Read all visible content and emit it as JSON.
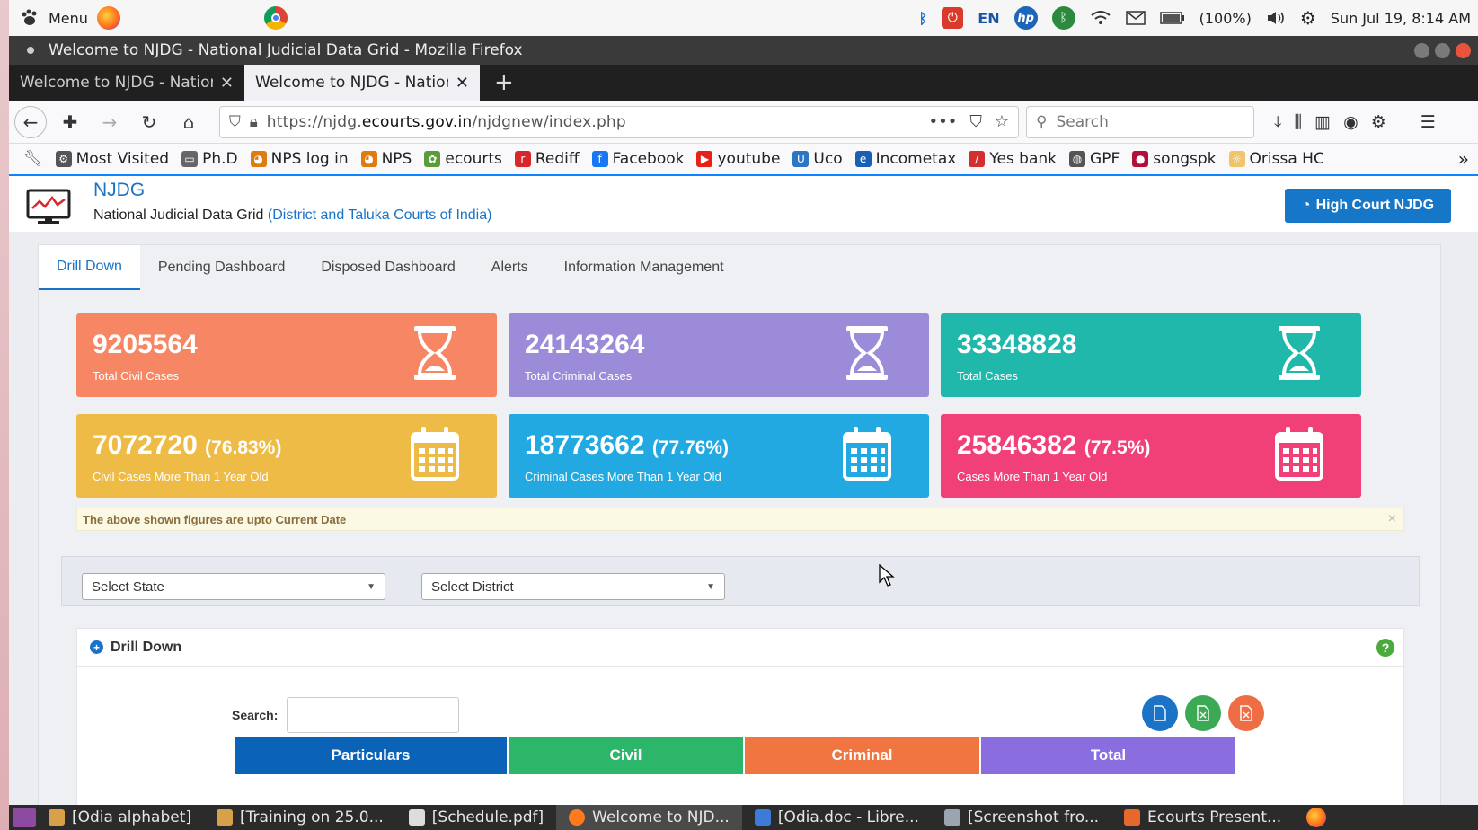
{
  "system_panel": {
    "menu_label": "Menu",
    "language": "EN",
    "battery": "(100%)",
    "datetime": "Sun Jul 19,  8:14 AM"
  },
  "window": {
    "title": "Welcome to NJDG - National Judicial Data Grid - Mozilla Firefox"
  },
  "browser_tabs": [
    {
      "label": "Welcome to NJDG - Nationa"
    },
    {
      "label": "Welcome to NJDG - Nationa"
    }
  ],
  "navbar": {
    "url_prefix": "https://njdg.",
    "url_domain": "ecourts.gov.in",
    "url_path": "/njdgnew/index.php",
    "search_placeholder": "Search"
  },
  "bookmarks": [
    {
      "label": "Most Visited",
      "icon": "gear-icon",
      "color": "#555555"
    },
    {
      "label": "Ph.D",
      "icon": "folder-icon",
      "color": "#666666"
    },
    {
      "label": "NPS log in",
      "icon": "nps-icon",
      "color": "#e07b10"
    },
    {
      "label": "NPS",
      "icon": "nps-icon",
      "color": "#e07b10"
    },
    {
      "label": "ecourts",
      "icon": "ecourts-icon",
      "color": "#5a9c3a"
    },
    {
      "label": "Rediff",
      "icon": "rediff-icon",
      "color": "#d8262b"
    },
    {
      "label": "Facebook",
      "icon": "facebook-icon",
      "color": "#1877f2"
    },
    {
      "label": "youtube",
      "icon": "youtube-icon",
      "color": "#e62117"
    },
    {
      "label": "Uco",
      "icon": "uco-icon",
      "color": "#2c77c4"
    },
    {
      "label": "Incometax",
      "icon": "incometax-icon",
      "color": "#1a5fb4"
    },
    {
      "label": "Yes bank",
      "icon": "yesbank-icon",
      "color": "#d32f2f"
    },
    {
      "label": "GPF",
      "icon": "globe-icon",
      "color": "#555555"
    },
    {
      "label": "songspk",
      "icon": "songspk-icon",
      "color": "#b0103a"
    },
    {
      "label": "Orissa HC",
      "icon": "orissahc-icon",
      "color": "#f1c36b"
    }
  ],
  "header": {
    "site_name": "NJDG",
    "subtitle": "National Judicial Data Grid",
    "subtitle_paren": "(District and Taluka Courts of India)",
    "hc_button": "High Court NJDG"
  },
  "nav_tabs": [
    {
      "label": "Drill Down",
      "active": true
    },
    {
      "label": "Pending Dashboard"
    },
    {
      "label": "Disposed Dashboard"
    },
    {
      "label": "Alerts"
    },
    {
      "label": "Information Management"
    }
  ],
  "cards": [
    {
      "value": "9205564",
      "pct": "",
      "label": "Total Civil Cases",
      "icon": "hourglass-icon",
      "color": "#f78764"
    },
    {
      "value": "24143264",
      "pct": "",
      "label": "Total Criminal Cases",
      "icon": "hourglass-icon",
      "color": "#9c8bd8"
    },
    {
      "value": "33348828",
      "pct": "",
      "label": "Total Cases",
      "icon": "hourglass-icon",
      "color": "#21b8ac"
    },
    {
      "value": "7072720",
      "pct": "(76.83%)",
      "label": "Civil Cases More Than 1 Year Old",
      "icon": "calendar-icon",
      "color": "#eebc46"
    },
    {
      "value": "18773662",
      "pct": "(77.76%)",
      "label": "Criminal Cases More Than 1 Year Old",
      "icon": "calendar-icon",
      "color": "#23a9e1"
    },
    {
      "value": "25846382",
      "pct": "(77.5%)",
      "label": "Cases More Than 1 Year Old",
      "icon": "calendar-icon",
      "color": "#f13f77"
    }
  ],
  "alert": {
    "text": "The above shown figures are upto Current Date",
    "close": "×"
  },
  "filters": {
    "state": "Select State",
    "district": "Select District"
  },
  "drill_down": {
    "title": "Drill Down",
    "search_label": "Search:",
    "help": "?",
    "columns": [
      {
        "label": "Particulars",
        "color": "#0b63b8"
      },
      {
        "label": "Civil",
        "color": "#2cb66a"
      },
      {
        "label": "Criminal",
        "color": "#f07540"
      },
      {
        "label": "Total",
        "color": "#8a6ee0"
      }
    ]
  },
  "taskbar": [
    {
      "label": "[Odia alphabet]",
      "icon": "folder-icon"
    },
    {
      "label": "[Training on 25.0...",
      "icon": "folder-icon"
    },
    {
      "label": "[Schedule.pdf]",
      "icon": "pdf-icon"
    },
    {
      "label": "Welcome to NJD...",
      "icon": "firefox-icon",
      "active": true
    },
    {
      "label": "[Odia.doc - Libre...",
      "icon": "doc-icon"
    },
    {
      "label": "[Screenshot fro...",
      "icon": "image-icon"
    },
    {
      "label": "Ecourts Present...",
      "icon": "presentation-icon"
    }
  ]
}
